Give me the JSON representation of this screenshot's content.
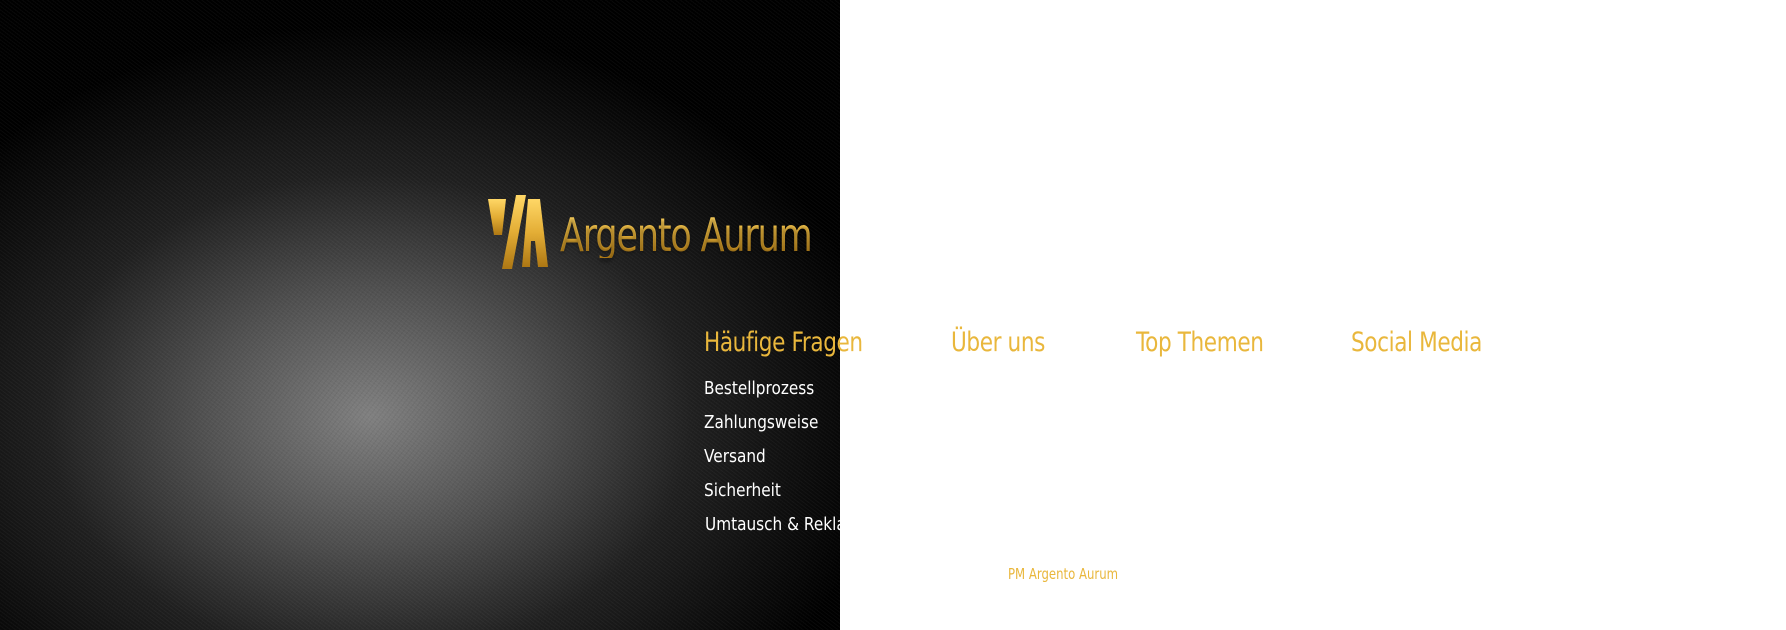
{
  "brand": {
    "name": "Argento Aurum",
    "logo_icon": "argento-aurum-monogram"
  },
  "colors": {
    "gold": "#e9b73c",
    "panel_dark": "#000000",
    "link_text": "#ffffff",
    "page_bg": "#ffffff"
  },
  "nav": {
    "faq_heading": "Häufige Fragen",
    "about_heading": "Über uns",
    "topics_heading": "Top Themen",
    "social_heading": "Social Media"
  },
  "faq_links": [
    "Bestellprozess",
    "Zahlungsweise",
    "Versand",
    "Sicherheit",
    "Umtausch & Reklamation"
  ],
  "footer": {
    "note": "PM Argento Aurum"
  }
}
